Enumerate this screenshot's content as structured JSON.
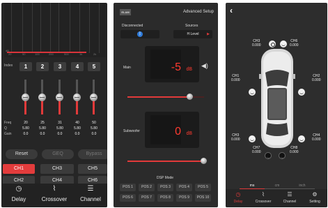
{
  "screen1": {
    "graph": {
      "freq_labels": [
        "20",
        "50",
        "100",
        "200",
        "500",
        "1k",
        "2k"
      ],
      "db_label": "dB"
    },
    "index_label": "Index",
    "bands": [
      {
        "index": "1",
        "freq": "20",
        "q": "5.80",
        "gain": "0.0",
        "level": 0.5
      },
      {
        "index": "2",
        "freq": "25",
        "q": "5.80",
        "gain": "0.0",
        "level": 0.5
      },
      {
        "index": "3",
        "freq": "31",
        "q": "5.80",
        "gain": "0.0",
        "level": 0.5
      },
      {
        "index": "4",
        "freq": "40",
        "q": "5.80",
        "gain": "0.0",
        "level": 0.5
      },
      {
        "index": "5",
        "freq": "50",
        "q": "5.80",
        "gain": "0.0",
        "level": 0.5
      }
    ],
    "row_labels": {
      "freq": "Freq",
      "q": "Q",
      "gain": "Gain"
    },
    "buttons": {
      "reset": "Reset",
      "geq": "GEQ",
      "bypass": "Bypass"
    },
    "channels": [
      "CH1",
      "CH3",
      "CH5",
      "CH2",
      "CH4",
      "CH6"
    ],
    "active_channel": "CH1",
    "nav": [
      {
        "icon": "clock-icon",
        "label": "Delay"
      },
      {
        "icon": "crossover-icon",
        "label": "Crossover"
      },
      {
        "icon": "sliders-icon",
        "label": "Channel"
      }
    ],
    "accent_color": "#e23a3a"
  },
  "screen2": {
    "logo_text": "ELAM",
    "title": "Advanced Setup",
    "connection_label": "Disconnected",
    "sources_label": "Sources",
    "source_value": "H Level",
    "main_label": "Main",
    "main_value": "-5",
    "main_unit": "dB",
    "main_level": 0.82,
    "sub_label": "Subwoofer",
    "sub_value": "0",
    "sub_unit": "dB",
    "sub_level": 1.0,
    "dsp_mode_label": "DSP Mode",
    "positions": [
      "POS 1",
      "POS 2",
      "POS 3",
      "POS 4",
      "POS 5",
      "POS 6",
      "POS 7",
      "POS 8",
      "POS 9",
      "POS 10"
    ],
    "value_color": "#ff3b30"
  },
  "screen3": {
    "speakers": [
      {
        "name": "CH3",
        "value": "0.000"
      },
      {
        "name": "CH6",
        "value": "0.000"
      },
      {
        "name": "CH1",
        "value": "0.000"
      },
      {
        "name": "CH2",
        "value": "0.000"
      },
      {
        "name": "CH3",
        "value": "0.000"
      },
      {
        "name": "CH4",
        "value": "0.000"
      },
      {
        "name": "CH7",
        "value": "0.000"
      },
      {
        "name": "CH8",
        "value": "0.000"
      }
    ],
    "units": [
      "ms",
      "cm",
      "inch"
    ],
    "selected_unit": "ms",
    "nav": [
      {
        "icon": "clock-icon",
        "label": "Delay"
      },
      {
        "icon": "crossover-icon",
        "label": "Crossover"
      },
      {
        "icon": "sliders-icon",
        "label": "Channel"
      },
      {
        "icon": "gear-icon",
        "label": "Setting"
      }
    ],
    "active_nav": "Delay"
  }
}
